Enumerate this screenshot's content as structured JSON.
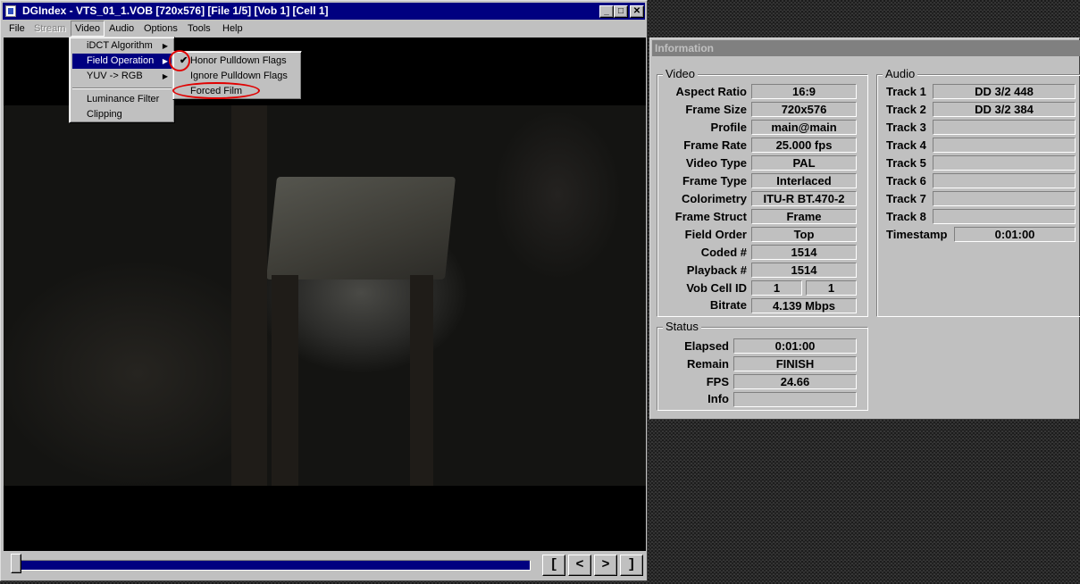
{
  "main_window": {
    "title": "DGIndex - VTS_01_1.VOB [720x576] [File 1/5] [Vob 1] [Cell 1]",
    "title_buttons": [
      "_",
      "□",
      "✕"
    ],
    "menubar": [
      "File",
      "Stream",
      "Video",
      "Audio",
      "Options",
      "Tools",
      "Help"
    ]
  },
  "video_menu": {
    "items": [
      "iDCT Algorithm",
      "Field Operation",
      "YUV -> RGB",
      "Luminance Filter",
      "Clipping"
    ],
    "arrow": "▶"
  },
  "field_menu": {
    "items": [
      "Honor Pulldown Flags",
      "Ignore Pulldown Flags",
      "Forced Film"
    ],
    "check": "✔"
  },
  "nav_buttons": [
    "[",
    "<",
    ">",
    "]"
  ],
  "info_window": {
    "title": "Information",
    "video": {
      "title": "Video",
      "rows": [
        {
          "label": "Aspect Ratio",
          "value": "16:9"
        },
        {
          "label": "Frame Size",
          "value": "720x576"
        },
        {
          "label": "Profile",
          "value": "main@main"
        },
        {
          "label": "Frame Rate",
          "value": "25.000 fps"
        },
        {
          "label": "Video Type",
          "value": "PAL"
        },
        {
          "label": "Frame Type",
          "value": "Interlaced"
        },
        {
          "label": "Colorimetry",
          "value": "ITU-R BT.470-2"
        },
        {
          "label": "Frame Struct",
          "value": "Frame"
        },
        {
          "label": "Field Order",
          "value": "Top"
        },
        {
          "label": "Coded #",
          "value": "1514"
        },
        {
          "label": "Playback #",
          "value": "1514"
        }
      ],
      "vob_cell": {
        "label": "Vob Cell ID",
        "vob": "1",
        "cell": "1"
      },
      "bitrate": {
        "label": "Bitrate",
        "value": "4.139 Mbps"
      }
    },
    "audio": {
      "title": "Audio",
      "tracks": [
        {
          "label": "Track 1",
          "value": "DD 3/2 448"
        },
        {
          "label": "Track 2",
          "value": "DD 3/2 384"
        },
        {
          "label": "Track 3",
          "value": ""
        },
        {
          "label": "Track 4",
          "value": ""
        },
        {
          "label": "Track 5",
          "value": ""
        },
        {
          "label": "Track 6",
          "value": ""
        },
        {
          "label": "Track 7",
          "value": ""
        },
        {
          "label": "Track 8",
          "value": ""
        }
      ],
      "timestamp": {
        "label": "Timestamp",
        "value": "0:01:00"
      }
    },
    "status": {
      "title": "Status",
      "rows": [
        {
          "label": "Elapsed",
          "value": "0:01:00"
        },
        {
          "label": "Remain",
          "value": "FINISH"
        },
        {
          "label": "FPS",
          "value": "24.66"
        },
        {
          "label": "Info",
          "value": ""
        }
      ]
    }
  }
}
